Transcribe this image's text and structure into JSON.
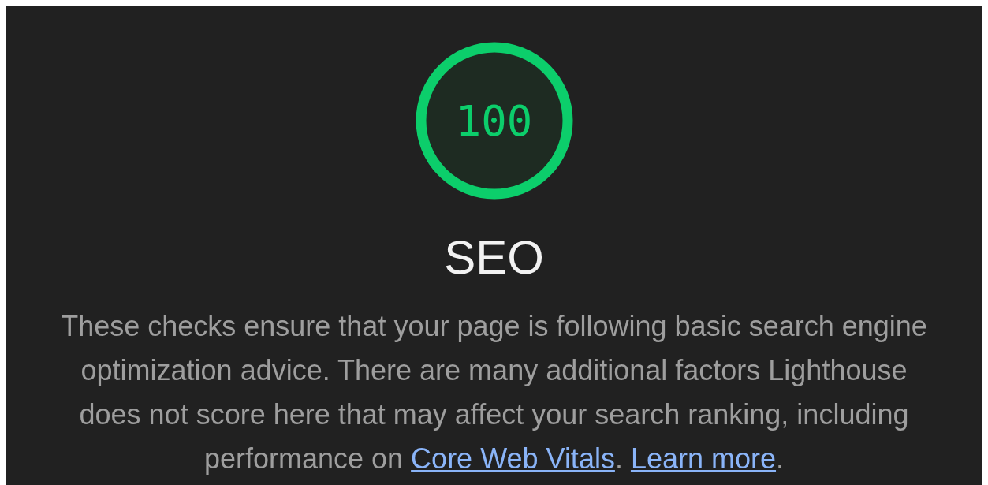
{
  "gauge": {
    "score": "100",
    "level": 1
  },
  "title": "SEO",
  "description": [
    {
      "kind": "text",
      "text": "These checks ensure that your page is following basic search engine optimization advice. There are many additional factors Lighthouse does not score here that may affect your search ranking, including performance on "
    },
    {
      "kind": "link",
      "text": "Core Web Vitals"
    },
    {
      "kind": "text",
      "text": ". "
    },
    {
      "kind": "link",
      "text": "Learn more"
    },
    {
      "kind": "text",
      "text": "."
    }
  ]
}
